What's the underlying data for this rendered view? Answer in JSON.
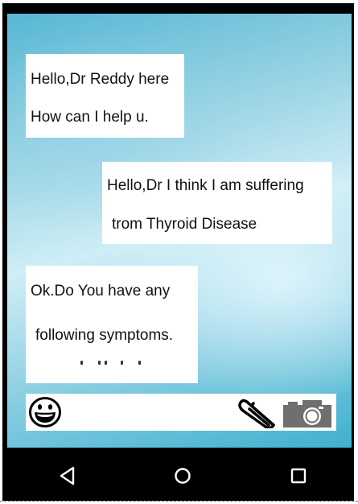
{
  "chat": {
    "messages": [
      {
        "sender": "doctor",
        "lines": [
          "Hello,Dr Reddy here",
          "How can I help u."
        ]
      },
      {
        "sender": "patient",
        "lines": [
          "Hello,Dr I think I am suffering",
          "trom Thyroid Disease"
        ]
      },
      {
        "sender": "doctor",
        "lines": [
          "Ok.Do You have any",
          "following symptoms."
        ]
      }
    ]
  },
  "input_bar": {
    "icons": [
      "smiley-face-icon",
      "paperclip-icon",
      "camera-icon"
    ]
  },
  "nav_bar": {
    "icons": [
      "back-triangle-icon",
      "home-circle-icon",
      "recent-apps-square-icon"
    ]
  },
  "colors": {
    "background_teal": "#57b7d3",
    "background_light": "#cfeef6",
    "bubble": "#ffffff",
    "nav_bar": "#000000",
    "text": "#111111",
    "camera_body": "#6f6f6f"
  }
}
